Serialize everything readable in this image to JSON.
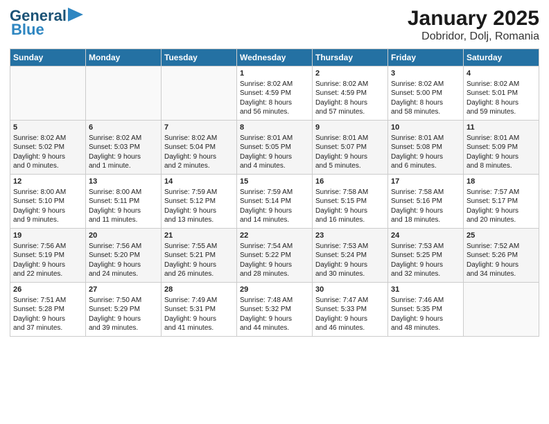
{
  "header": {
    "logo_line1": "General",
    "logo_line2": "Blue",
    "title": "January 2025",
    "subtitle": "Dobridor, Dolj, Romania"
  },
  "days_of_week": [
    "Sunday",
    "Monday",
    "Tuesday",
    "Wednesday",
    "Thursday",
    "Friday",
    "Saturday"
  ],
  "weeks": [
    [
      {
        "day": "",
        "content": ""
      },
      {
        "day": "",
        "content": ""
      },
      {
        "day": "",
        "content": ""
      },
      {
        "day": "1",
        "content": "Sunrise: 8:02 AM\nSunset: 4:59 PM\nDaylight: 8 hours\nand 56 minutes."
      },
      {
        "day": "2",
        "content": "Sunrise: 8:02 AM\nSunset: 4:59 PM\nDaylight: 8 hours\nand 57 minutes."
      },
      {
        "day": "3",
        "content": "Sunrise: 8:02 AM\nSunset: 5:00 PM\nDaylight: 8 hours\nand 58 minutes."
      },
      {
        "day": "4",
        "content": "Sunrise: 8:02 AM\nSunset: 5:01 PM\nDaylight: 8 hours\nand 59 minutes."
      }
    ],
    [
      {
        "day": "5",
        "content": "Sunrise: 8:02 AM\nSunset: 5:02 PM\nDaylight: 9 hours\nand 0 minutes."
      },
      {
        "day": "6",
        "content": "Sunrise: 8:02 AM\nSunset: 5:03 PM\nDaylight: 9 hours\nand 1 minute."
      },
      {
        "day": "7",
        "content": "Sunrise: 8:02 AM\nSunset: 5:04 PM\nDaylight: 9 hours\nand 2 minutes."
      },
      {
        "day": "8",
        "content": "Sunrise: 8:01 AM\nSunset: 5:05 PM\nDaylight: 9 hours\nand 4 minutes."
      },
      {
        "day": "9",
        "content": "Sunrise: 8:01 AM\nSunset: 5:07 PM\nDaylight: 9 hours\nand 5 minutes."
      },
      {
        "day": "10",
        "content": "Sunrise: 8:01 AM\nSunset: 5:08 PM\nDaylight: 9 hours\nand 6 minutes."
      },
      {
        "day": "11",
        "content": "Sunrise: 8:01 AM\nSunset: 5:09 PM\nDaylight: 9 hours\nand 8 minutes."
      }
    ],
    [
      {
        "day": "12",
        "content": "Sunrise: 8:00 AM\nSunset: 5:10 PM\nDaylight: 9 hours\nand 9 minutes."
      },
      {
        "day": "13",
        "content": "Sunrise: 8:00 AM\nSunset: 5:11 PM\nDaylight: 9 hours\nand 11 minutes."
      },
      {
        "day": "14",
        "content": "Sunrise: 7:59 AM\nSunset: 5:12 PM\nDaylight: 9 hours\nand 13 minutes."
      },
      {
        "day": "15",
        "content": "Sunrise: 7:59 AM\nSunset: 5:14 PM\nDaylight: 9 hours\nand 14 minutes."
      },
      {
        "day": "16",
        "content": "Sunrise: 7:58 AM\nSunset: 5:15 PM\nDaylight: 9 hours\nand 16 minutes."
      },
      {
        "day": "17",
        "content": "Sunrise: 7:58 AM\nSunset: 5:16 PM\nDaylight: 9 hours\nand 18 minutes."
      },
      {
        "day": "18",
        "content": "Sunrise: 7:57 AM\nSunset: 5:17 PM\nDaylight: 9 hours\nand 20 minutes."
      }
    ],
    [
      {
        "day": "19",
        "content": "Sunrise: 7:56 AM\nSunset: 5:19 PM\nDaylight: 9 hours\nand 22 minutes."
      },
      {
        "day": "20",
        "content": "Sunrise: 7:56 AM\nSunset: 5:20 PM\nDaylight: 9 hours\nand 24 minutes."
      },
      {
        "day": "21",
        "content": "Sunrise: 7:55 AM\nSunset: 5:21 PM\nDaylight: 9 hours\nand 26 minutes."
      },
      {
        "day": "22",
        "content": "Sunrise: 7:54 AM\nSunset: 5:22 PM\nDaylight: 9 hours\nand 28 minutes."
      },
      {
        "day": "23",
        "content": "Sunrise: 7:53 AM\nSunset: 5:24 PM\nDaylight: 9 hours\nand 30 minutes."
      },
      {
        "day": "24",
        "content": "Sunrise: 7:53 AM\nSunset: 5:25 PM\nDaylight: 9 hours\nand 32 minutes."
      },
      {
        "day": "25",
        "content": "Sunrise: 7:52 AM\nSunset: 5:26 PM\nDaylight: 9 hours\nand 34 minutes."
      }
    ],
    [
      {
        "day": "26",
        "content": "Sunrise: 7:51 AM\nSunset: 5:28 PM\nDaylight: 9 hours\nand 37 minutes."
      },
      {
        "day": "27",
        "content": "Sunrise: 7:50 AM\nSunset: 5:29 PM\nDaylight: 9 hours\nand 39 minutes."
      },
      {
        "day": "28",
        "content": "Sunrise: 7:49 AM\nSunset: 5:31 PM\nDaylight: 9 hours\nand 41 minutes."
      },
      {
        "day": "29",
        "content": "Sunrise: 7:48 AM\nSunset: 5:32 PM\nDaylight: 9 hours\nand 44 minutes."
      },
      {
        "day": "30",
        "content": "Sunrise: 7:47 AM\nSunset: 5:33 PM\nDaylight: 9 hours\nand 46 minutes."
      },
      {
        "day": "31",
        "content": "Sunrise: 7:46 AM\nSunset: 5:35 PM\nDaylight: 9 hours\nand 48 minutes."
      },
      {
        "day": "",
        "content": ""
      }
    ]
  ]
}
